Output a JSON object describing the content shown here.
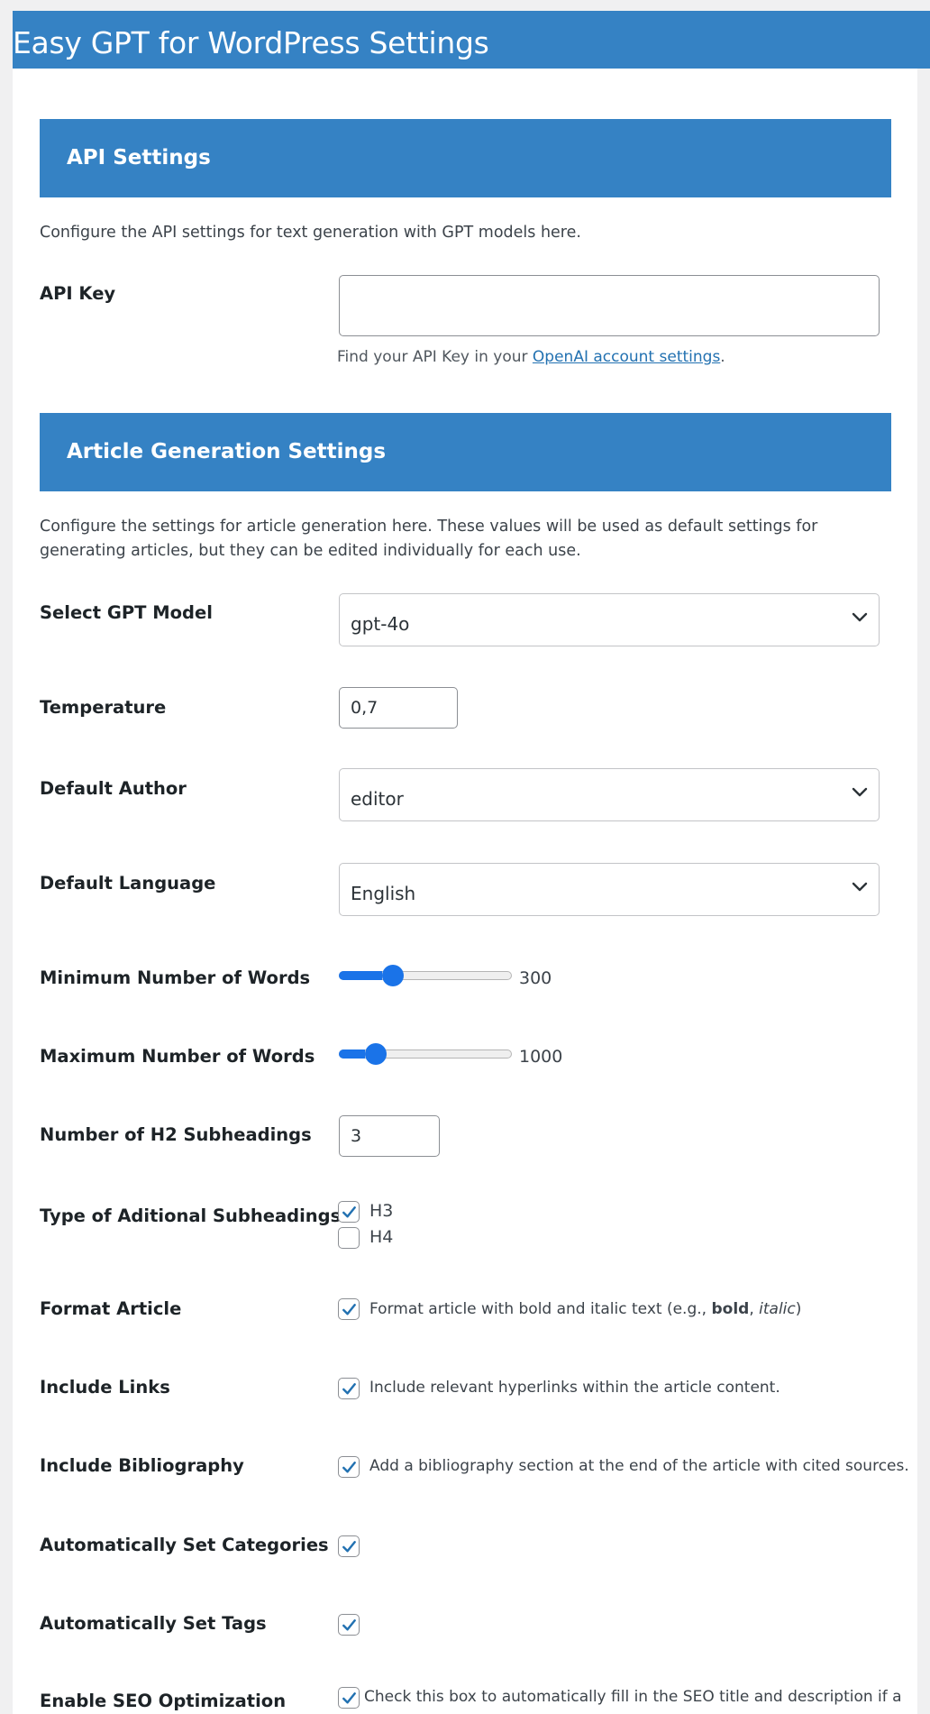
{
  "page": {
    "title": "Easy GPT for WordPress Settings"
  },
  "api_settings": {
    "header": "API Settings",
    "description": "Configure the API settings for text generation with GPT models here.",
    "api_key": {
      "label": "API Key",
      "value": "",
      "help_prefix": "Find your API Key in your ",
      "help_link": "OpenAI account settings",
      "help_suffix": "."
    }
  },
  "article_settings": {
    "header": "Article Generation Settings",
    "description": "Configure the settings for article generation here. These values will be used as default settings for generating articles, but they can be edited individually for each use.",
    "model": {
      "label": "Select GPT Model",
      "value": "gpt-4o"
    },
    "temperature": {
      "label": "Temperature",
      "value": "0,7"
    },
    "author": {
      "label": "Default Author",
      "value": "editor"
    },
    "language": {
      "label": "Default Language",
      "value": "English"
    },
    "min_words": {
      "label": "Minimum Number of Words",
      "value": "300",
      "fill_fraction": 0.25
    },
    "max_words": {
      "label": "Maximum Number of Words",
      "value": "1000",
      "fill_fraction": 0.15
    },
    "h2_count": {
      "label": "Number of H2 Subheadings",
      "value": "3"
    },
    "subheading_types": {
      "label": "Type of Aditional Subheadings",
      "options": [
        {
          "label": "H3",
          "checked": true
        },
        {
          "label": "H4",
          "checked": false
        }
      ]
    },
    "format_article": {
      "label": "Format Article",
      "checked": true,
      "text_prefix": "Format article with bold and italic text (e.g., ",
      "bold_word": "bold",
      "separator": ", ",
      "italic_word": "italic",
      "text_suffix": ")"
    },
    "include_links": {
      "label": "Include Links",
      "checked": true,
      "text": "Include relevant hyperlinks within the article content."
    },
    "include_bibliography": {
      "label": "Include Bibliography",
      "checked": true,
      "text": "Add a bibliography section at the end of the article with cited sources."
    },
    "auto_categories": {
      "label": "Automatically Set Categories",
      "checked": true
    },
    "auto_tags": {
      "label": "Automatically Set Tags",
      "checked": true
    },
    "seo": {
      "label": "Enable SEO Optimization",
      "checked": true,
      "text": "Check this box to automatically fill in the SEO title and description if a"
    }
  },
  "colors": {
    "accent": "#3582c4",
    "slider": "#1a73e8",
    "checkmark": "#2271b1",
    "link": "#2271b1"
  },
  "icons": {
    "select_arrow": "chevron-down-icon",
    "checkbox_mark": "checkmark-icon"
  }
}
